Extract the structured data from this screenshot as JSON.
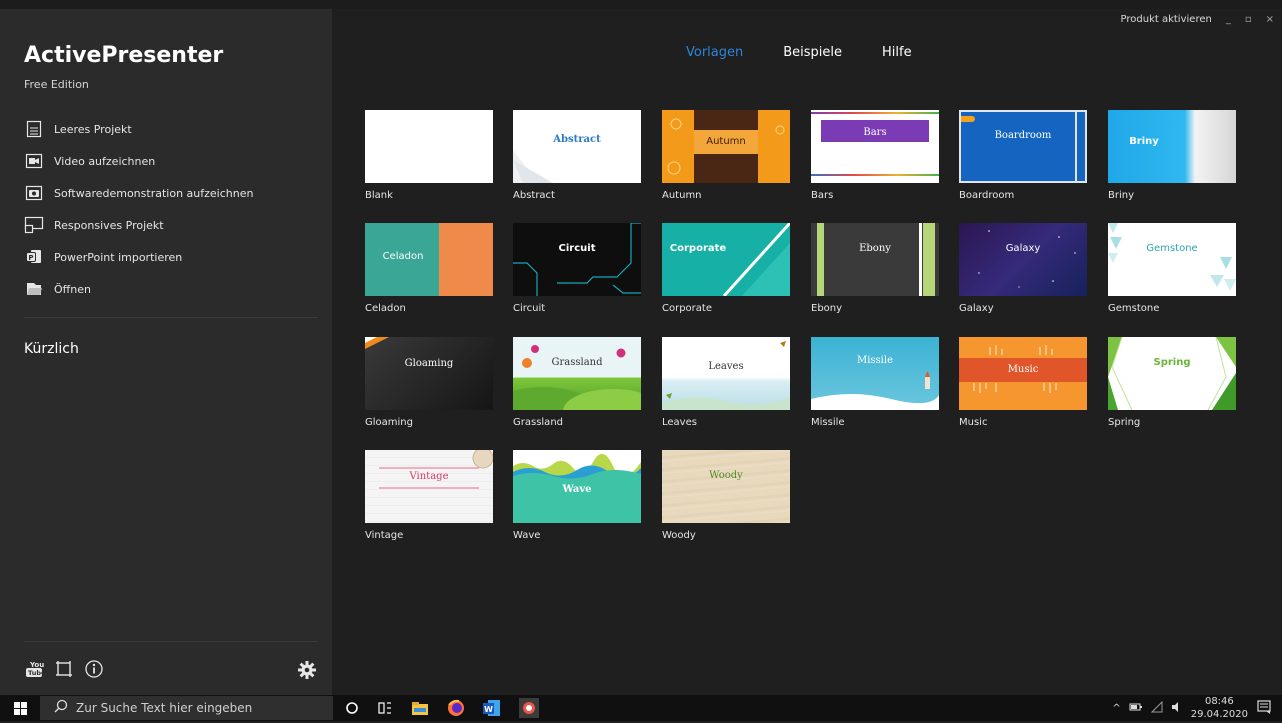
{
  "window": {
    "activate_label": "Produkt aktivieren",
    "minimize": "_",
    "maximize": "▫",
    "close": "×"
  },
  "app": {
    "title": "ActivePresenter",
    "edition": "Free Edition"
  },
  "menu": [
    {
      "label": "Leeres Projekt",
      "icon": "blank-document-icon"
    },
    {
      "label": "Video aufzeichnen",
      "icon": "video-camera-icon"
    },
    {
      "label": "Softwaredemonstration aufzeichnen",
      "icon": "camera-icon"
    },
    {
      "label": "Responsives Projekt",
      "icon": "responsive-icon"
    },
    {
      "label": "PowerPoint importieren",
      "icon": "powerpoint-icon"
    },
    {
      "label": "Öffnen",
      "icon": "open-folder-icon"
    }
  ],
  "recent": {
    "heading": "Kürzlich"
  },
  "tabs": [
    {
      "label": "Vorlagen",
      "active": true
    },
    {
      "label": "Beispiele",
      "active": false
    },
    {
      "label": "Hilfe",
      "active": false
    }
  ],
  "templates": [
    {
      "name": "Blank",
      "thumb_text": ""
    },
    {
      "name": "Abstract",
      "thumb_text": "Abstract"
    },
    {
      "name": "Autumn",
      "thumb_text": "Autumn"
    },
    {
      "name": "Bars",
      "thumb_text": "Bars"
    },
    {
      "name": "Boardroom",
      "thumb_text": "Boardroom"
    },
    {
      "name": "Briny",
      "thumb_text": "Briny"
    },
    {
      "name": "Celadon",
      "thumb_text": "Celadon"
    },
    {
      "name": "Circuit",
      "thumb_text": "Circuit"
    },
    {
      "name": "Corporate",
      "thumb_text": "Corporate"
    },
    {
      "name": "Ebony",
      "thumb_text": "Ebony"
    },
    {
      "name": "Galaxy",
      "thumb_text": "Galaxy"
    },
    {
      "name": "Gemstone",
      "thumb_text": "Gemstone"
    },
    {
      "name": "Gloaming",
      "thumb_text": "Gloaming"
    },
    {
      "name": "Grassland",
      "thumb_text": "Grassland"
    },
    {
      "name": "Leaves",
      "thumb_text": "Leaves"
    },
    {
      "name": "Missile",
      "thumb_text": "Missile"
    },
    {
      "name": "Music",
      "thumb_text": "Music"
    },
    {
      "name": "Spring",
      "thumb_text": "Spring"
    },
    {
      "name": "Vintage",
      "thumb_text": "Vintage"
    },
    {
      "name": "Wave",
      "thumb_text": "Wave"
    },
    {
      "name": "Woody",
      "thumb_text": "Woody"
    }
  ],
  "taskbar": {
    "search_placeholder": "Zur Suche Text hier eingeben",
    "time": "08:46",
    "date": "29.04.2020"
  },
  "colors": {
    "accent": "#2e86d8",
    "sidebar": "#2b2b2b",
    "main": "#1f1f1f"
  }
}
